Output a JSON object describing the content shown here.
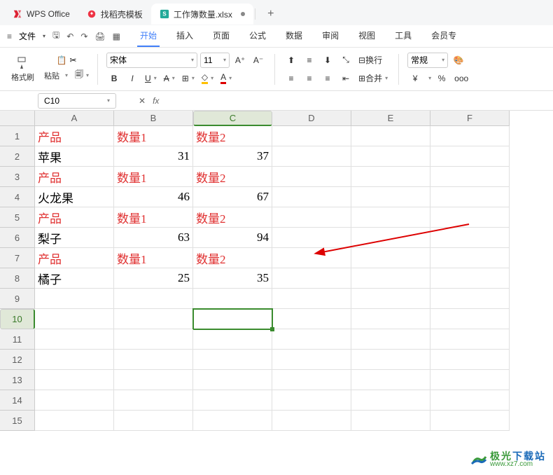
{
  "tabs": [
    {
      "label": "WPS Office",
      "icon": "wps"
    },
    {
      "label": "找稻壳模板",
      "icon": "docer"
    },
    {
      "label": "工作簿数量.xlsx",
      "icon": "sheet",
      "active": true,
      "modified": true
    }
  ],
  "menubar": {
    "file": "文件",
    "items": [
      "开始",
      "插入",
      "页面",
      "公式",
      "数据",
      "审阅",
      "视图",
      "工具",
      "会员专"
    ],
    "activeIndex": 0
  },
  "ribbon": {
    "format_painter": "格式刷",
    "paste": "粘贴",
    "font_name": "宋体",
    "font_size": "11",
    "wrap": "换行",
    "merge": "合并",
    "number_format": "常规",
    "currency": "¥",
    "percent": "%"
  },
  "namebox": "C10",
  "fx": "fx",
  "columns": [
    "A",
    "B",
    "C",
    "D",
    "E",
    "F"
  ],
  "selectedCol": 2,
  "rows": [
    1,
    2,
    3,
    4,
    5,
    6,
    7,
    8,
    9,
    10,
    11,
    12,
    13,
    14,
    15
  ],
  "selectedRow": 10,
  "selectedCell": {
    "col": 2,
    "row": 10
  },
  "data": {
    "1": {
      "A": {
        "v": "产品",
        "hdr": true
      },
      "B": {
        "v": "数量1",
        "hdr": true
      },
      "C": {
        "v": "数量2",
        "hdr": true
      }
    },
    "2": {
      "A": {
        "v": "苹果"
      },
      "B": {
        "v": "31",
        "num": true
      },
      "C": {
        "v": "37",
        "num": true
      }
    },
    "3": {
      "A": {
        "v": "产品",
        "hdr": true
      },
      "B": {
        "v": "数量1",
        "hdr": true
      },
      "C": {
        "v": "数量2",
        "hdr": true
      }
    },
    "4": {
      "A": {
        "v": "火龙果"
      },
      "B": {
        "v": "46",
        "num": true
      },
      "C": {
        "v": "67",
        "num": true
      }
    },
    "5": {
      "A": {
        "v": "产品",
        "hdr": true
      },
      "B": {
        "v": "数量1",
        "hdr": true
      },
      "C": {
        "v": "数量2",
        "hdr": true
      }
    },
    "6": {
      "A": {
        "v": "梨子"
      },
      "B": {
        "v": "63",
        "num": true
      },
      "C": {
        "v": "94",
        "num": true
      }
    },
    "7": {
      "A": {
        "v": "产品",
        "hdr": true
      },
      "B": {
        "v": "数量1",
        "hdr": true
      },
      "C": {
        "v": "数量2",
        "hdr": true
      }
    },
    "8": {
      "A": {
        "v": "橘子"
      },
      "B": {
        "v": "25",
        "num": true
      },
      "C": {
        "v": "35",
        "num": true
      }
    }
  },
  "watermark": {
    "line1a": "极光",
    "line1b": "下载站",
    "line2": "www.xz7.com"
  }
}
